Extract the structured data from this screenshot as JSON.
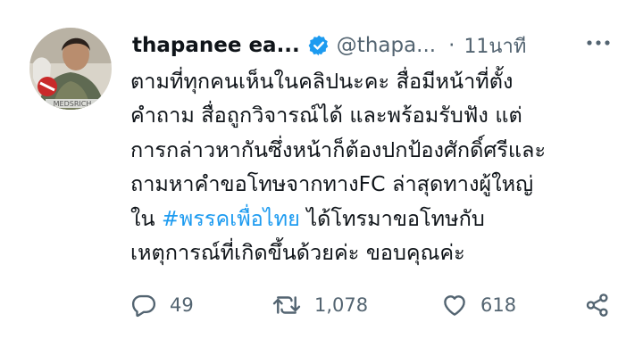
{
  "tweet": {
    "author_name": "thapanee ea...",
    "author_handle": "@thapa...",
    "separator": "·",
    "time_ago": "11นาที",
    "text_lines": [
      "ตามที่ทุกคนเห็นในคลิปนะคะ สื่อมีหน้าที่ตั้ง",
      "คำถาม สื่อถูกวิจารณ์ได้ และพร้อมรับฟัง แต่",
      "การกล่าวหากันซึ่งหน้าก็ต้องปกป้องศักดิ์ศรีและ",
      "ถามหาคำขอโทษจากทางFC ล่าสุดทางผู้ใหญ่"
    ],
    "line5_before": "ใน ",
    "hashtag": "#พรรคเพื่อไทย",
    "line5_after": " ได้โทรมาขอโทษกับ",
    "line6": "เหตุการณ์ที่เกิดขึ้นด้วยค่ะ ขอบคุณค่ะ",
    "avatar_caption": "MEDSRICH"
  },
  "actions": {
    "reply_count": "49",
    "retweet_count": "1,078",
    "like_count": "618"
  },
  "icons": {
    "verified": "verified-badge-icon",
    "more": "more-options-icon",
    "reply": "reply-icon",
    "retweet": "retweet-icon",
    "like": "heart-icon",
    "share": "share-icon"
  },
  "colors": {
    "text": "#0f1419",
    "secondary": "#536471",
    "link": "#1d9bf0",
    "verified_blue": "#1d9bf0"
  }
}
